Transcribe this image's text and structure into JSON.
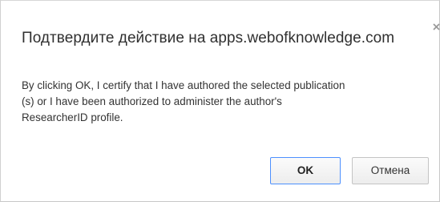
{
  "dialog": {
    "title": "Подтвердите действие на apps.webofknowledge.com",
    "close_icon": "close-icon",
    "message_lines": [
      "By clicking OK, I certify that I have authored the selected publication",
      "(s) or I have been authorized to administer the author's",
      "ResearcherID profile."
    ],
    "ok_label": "OK",
    "cancel_label": "Отмена"
  },
  "colors": {
    "ok_border": "#4d90fe",
    "text": "#333333"
  }
}
